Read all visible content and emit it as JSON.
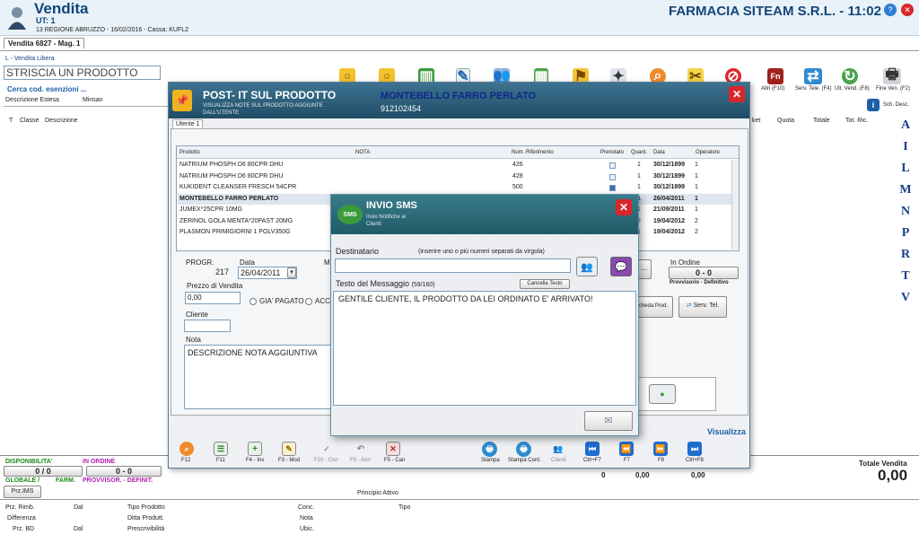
{
  "app": {
    "title": "Vendita",
    "ut": "UT: 1",
    "info": "13 REGIONE ABRUZZO - 16/02/2016 - Cassa: KUFL2",
    "company": "FARMACIA SITEAM S.R.L. - 11:02"
  },
  "tab": {
    "label": "Vendita 6827 - Mag. 1"
  },
  "main": {
    "vendita_libera": "L - Vendita Libera",
    "scan_placeholder": "STRISCIA UN PRODOTTO",
    "cerca_link": "Cerca cod. esenzioni ...",
    "col_descr": "Descrizione Estesa",
    "col_minsan": "Minsan",
    "col_t": "T",
    "col_classe": "Classe",
    "col_descr2": "Descrizione",
    "col_ket": "ket",
    "col_quota": "Quota",
    "col_totale": "Totale",
    "col_totric": "Tot. Ric.",
    "altri": "Altri (F10)",
    "serv_tele": "Serv. Tele. (F4)",
    "ult_vend": "Ult. Vend. (F8)",
    "fine_ven": "Fine Ven. (F2)",
    "sch_desc": "Sch. Desc.",
    "side_letters": [
      "A",
      "I",
      "L",
      "M",
      "N",
      "P",
      "R",
      "T",
      "V"
    ],
    "visualizza": "Visualizza"
  },
  "bottom": {
    "disponibilita": "DISPONIBILITA'",
    "in_ordine": "IN ORDINE",
    "disp_val": "0 / 0",
    "ord_val": "0 - 0",
    "globale": "GLOBALE /",
    "farm": "FARM.",
    "provvisor": "PROVVISOR. - DEFINIT.",
    "prz_ims": "Prz.IMS",
    "principio": "Principio Attivo",
    "totale_vendita": "Totale Vendita",
    "totale_val": "0,00",
    "tot_col1": "0",
    "tot_col2": "0,00",
    "tot_col3": "0,00",
    "labels": [
      "Prz. Rimb.",
      "Dal",
      "Tipo Prodotto",
      "Conc.",
      "Tipo",
      "Differenza",
      "Ditta Produtt.",
      "Nota",
      "Prz. BD",
      "Dal",
      "Prescrivibilità",
      "Ubic."
    ]
  },
  "postit": {
    "title": "POST- IT SUL PRODOTTO",
    "subtitle": "VISUALIZZA NOTE SUL PRODOTTO AGGIUNTE DALL'UTENTE",
    "product": "MONTEBELLO FARRO PERLATO",
    "code": "912102454",
    "tab": "Utente 1",
    "headers": [
      "Prodotto",
      "NOTA",
      "Num. Riferimento",
      "Prenotato",
      "Quant.",
      "Data",
      "Operatore"
    ],
    "rows": [
      {
        "p": "NATRIUM PHOSPH D6 80CPR DHU",
        "n": "426",
        "q": "1",
        "d": "30/12/1899",
        "o": "1"
      },
      {
        "p": "NATRIUM PHOSPH D6 80CPR DHU",
        "n": "428",
        "q": "1",
        "d": "30/12/1899",
        "o": "1"
      },
      {
        "p": "KUKIDENT CLEANSER FRESCH 54CPR",
        "n": "500",
        "q": "1",
        "d": "30/12/1899",
        "o": "1"
      },
      {
        "p": "MONTEBELLO FARRO PERLATO",
        "n": "",
        "q": "1",
        "d": "26/04/2011",
        "o": "1"
      },
      {
        "p": "JUMEX*25CPR 10MG",
        "n": "",
        "q": "1",
        "d": "21/09/2011",
        "o": "1"
      },
      {
        "p": "ZERINOL GOLA MENTA*20PAST 20MG",
        "n": "",
        "q": "2",
        "d": "19/04/2012",
        "o": "2"
      },
      {
        "p": "PLASMON PRIMIGIORNI 1 POLV350G",
        "n": "",
        "q": "1",
        "d": "19/04/2012",
        "o": "2"
      }
    ],
    "progr_label": "PROGR.",
    "progr": "217",
    "data_label": "Data",
    "data": "26/04/2011",
    "m_label": "M",
    "prezzo_label": "Prezzo di Vendita",
    "prezzo": "0,00",
    "gia_pagato": "GIA' PAGATO",
    "acc": "ACC",
    "cliente_label": "Cliente",
    "nota_label": "Nota",
    "nota": "DESCRIZIONE NOTA AGGIUNTIVA",
    "in_ordine": "In Ordine",
    "ordine_val": "0 - 0",
    "prov_def": "Provvisorio - Definitivo",
    "scheda": "cheda Prod.",
    "serv_tel": "Serv. Tel.",
    "dots": "...",
    "toolbar": [
      "F12",
      "F11",
      "F4 - Ins",
      "F3 - Mod",
      "F10 - Con",
      "F9 - Ann",
      "F5 - Can",
      "Stampa",
      "Stampa Cont.",
      "Clienti",
      "Ctrl+F7",
      "F7",
      "F8",
      "Ctrl+F8"
    ]
  },
  "sms": {
    "title": "INVIO SMS",
    "subtitle": "Invio Notifiche ai Clienti",
    "icon_text": "SMS",
    "dest_label": "Destinatario",
    "dest_hint": "(inserire uno o più numeri  separati da virgola)",
    "msg_label": "Testo del Messaggio",
    "count": "(59/160)",
    "cancella": "Cancella Testo",
    "message": "GENTILE CLIENTE, IL PRODOTTO DA LEI ORDINATO E' ARRIVATO!"
  },
  "colors": {
    "accent": "#1a5fa8",
    "header_bg": "#2a5f7a",
    "dialog_bg": "#eef0f3",
    "close_red": "#d9262b"
  }
}
